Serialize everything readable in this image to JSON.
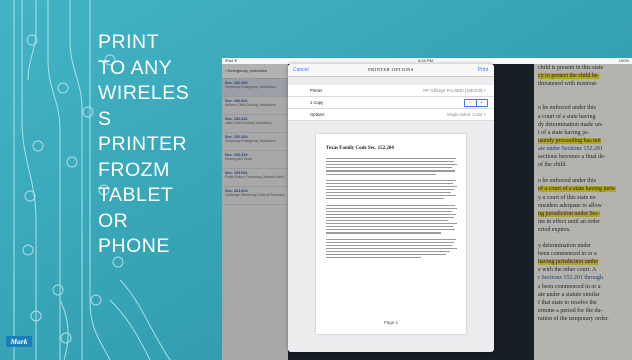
{
  "slide": {
    "title_lines": [
      "PRINT",
      "TO ANY",
      "WIRELES",
      "S",
      "PRINTER",
      "FROZM",
      "TABLET",
      "OR",
      "PHONE"
    ],
    "logo_text": "Mark",
    "background_color": "#36a3b6"
  },
  "screenshot": {
    "status_bar": {
      "left": "iPad ✈",
      "time": "3:24 PM",
      "right": "100%"
    },
    "sidebar": {
      "back_label": "Emergency, protective",
      "items": [
        {
          "title": "Sec. 152.204",
          "subtitle": "Temporary Emergency Jurisdiction",
          "highlight": true
        },
        {
          "title": "Sec. 152.001",
          "subtitle": "Uniform Child-Custody Jurisdiction",
          "highlight": false
        },
        {
          "title": "Sec. 152.201",
          "subtitle": "Initial Child Custody Jurisdiction",
          "highlight": false
        },
        {
          "title": "Sec. 152.204",
          "subtitle": "Temporary Emergency Jurisdiction",
          "highlight": false
        },
        {
          "title": "Sec. 152.310",
          "subtitle": "Hearing and Order",
          "highlight": false
        },
        {
          "title": "Sec. 153.001",
          "subtitle": "Public Policy; Promoting Children's Best Interest",
          "highlight": false
        },
        {
          "title": "Sec. 261.004",
          "subtitle": "Contempt; Rendering Order in Protective Order",
          "highlight": false
        }
      ]
    },
    "print_dialog": {
      "cancel_label": "Cancel",
      "title": "PRINTER OPTIONS",
      "print_label": "Print",
      "rows": [
        {
          "label": "Printer",
          "value": "HP Officejet Pro 8630 [18E4C8]  >"
        },
        {
          "label": "1 Copy",
          "value": ""
        },
        {
          "label": "Options",
          "value": "Single-sided, Color  >"
        }
      ],
      "stepper_minus": "−",
      "stepper_plus": "+",
      "preview_title": "Texas Family Code Sec. 152.204",
      "page_label": "Page 1"
    },
    "book_text": [
      {
        "text": "child is present in this state",
        "hl": false,
        "link": false
      },
      {
        "text": "cy to protect the child be-",
        "hl": true,
        "link": false
      },
      {
        "text": "threatened with mistreat-",
        "hl": false,
        "link": false
      },
      {
        "text": "",
        "hl": false,
        "link": false
      },
      {
        "text": "",
        "hl": false,
        "link": false
      },
      {
        "text": "o be enforced under this",
        "hl": false,
        "link": false
      },
      {
        "text": "a court of a state having",
        "hl": false,
        "link": false
      },
      {
        "text": "dy determination made un-",
        "hl": false,
        "link": false
      },
      {
        "text": "t of a state having ju-",
        "hl": false,
        "link": false
      },
      {
        "text": "ustody proceeding has not",
        "hl": true,
        "link": false
      },
      {
        "text": "ate under Sections 152.201",
        "hl": false,
        "link": true
      },
      {
        "text": "sections becomes a final de-",
        "hl": false,
        "link": false
      },
      {
        "text": "of the child.",
        "hl": false,
        "link": false
      },
      {
        "text": "",
        "hl": false,
        "link": false
      },
      {
        "text": "o be enforced under this",
        "hl": false,
        "link": false
      },
      {
        "text": "of a court of a state having juris-",
        "hl": true,
        "link": false
      },
      {
        "text": "y a court of this state no",
        "hl": false,
        "link": false
      },
      {
        "text": "onsiders adequate to allow",
        "hl": false,
        "link": false
      },
      {
        "text": "ng jurisdiction under Sec-",
        "hl": true,
        "link": false
      },
      {
        "text": "ins in effect until an order",
        "hl": false,
        "link": false
      },
      {
        "text": "eriod expires.",
        "hl": false,
        "link": false
      },
      {
        "text": "",
        "hl": false,
        "link": false
      },
      {
        "text": "y determination under",
        "hl": false,
        "link": false
      },
      {
        "text": "been commenced in or a",
        "hl": false,
        "link": false
      },
      {
        "text": "having jurisdiction under",
        "hl": true,
        "link": false
      },
      {
        "text": "e with the other court. A",
        "hl": false,
        "link": false
      },
      {
        "text": "r Sections 152.201 through",
        "hl": false,
        "link": true
      },
      {
        "text": "s been commenced in or a",
        "hl": false,
        "link": false
      },
      {
        "text": "ate under a statute similar",
        "hl": false,
        "link": false
      },
      {
        "text": "f that state to resolve the",
        "hl": false,
        "link": false
      },
      {
        "text": "ermine a period for the du-",
        "hl": false,
        "link": false
      },
      {
        "text": "ration of the temporary order.",
        "hl": false,
        "link": false
      }
    ]
  }
}
